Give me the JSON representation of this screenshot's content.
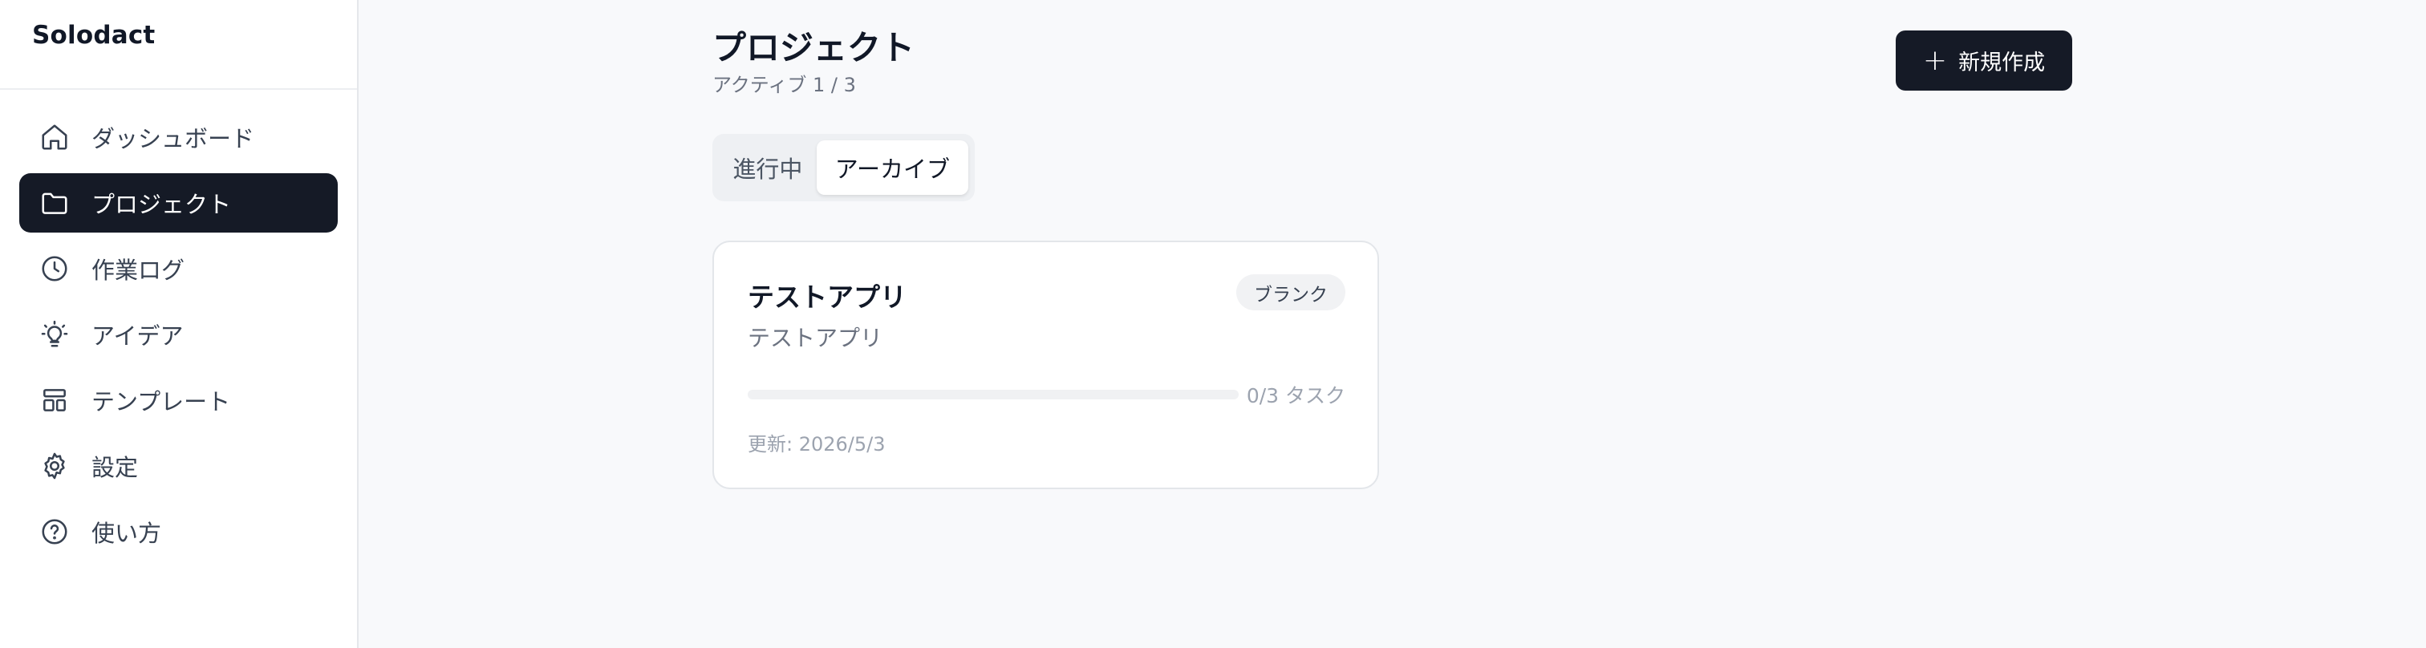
{
  "app": {
    "brand": "Solodact"
  },
  "sidebar": {
    "items": [
      {
        "label": "ダッシュボード",
        "icon": "home-icon",
        "active": false
      },
      {
        "label": "プロジェクト",
        "icon": "folder-icon",
        "active": true
      },
      {
        "label": "作業ログ",
        "icon": "clock-icon",
        "active": false
      },
      {
        "label": "アイデア",
        "icon": "lightbulb-icon",
        "active": false
      },
      {
        "label": "テンプレート",
        "icon": "layout-icon",
        "active": false
      },
      {
        "label": "設定",
        "icon": "gear-icon",
        "active": false
      },
      {
        "label": "使い方",
        "icon": "help-circle-icon",
        "active": false
      }
    ]
  },
  "header": {
    "title": "プロジェクト",
    "subtitle": "アクティブ 1 / 3",
    "new_button": {
      "label": "新規作成",
      "icon": "plus-icon"
    }
  },
  "tabs": [
    {
      "label": "進行中",
      "active": false
    },
    {
      "label": "アーカイブ",
      "active": true
    }
  ],
  "projects": [
    {
      "title": "テストアプリ",
      "badge": "ブランク",
      "description": "テストアプリ",
      "progress": 0,
      "progress_text": "0/3 タスク",
      "updated": "更新: 2026/5/3"
    }
  ],
  "colors": {
    "accent": "#151a26",
    "background": "#f8f9fb",
    "sidebar_bg": "#ffffff"
  }
}
